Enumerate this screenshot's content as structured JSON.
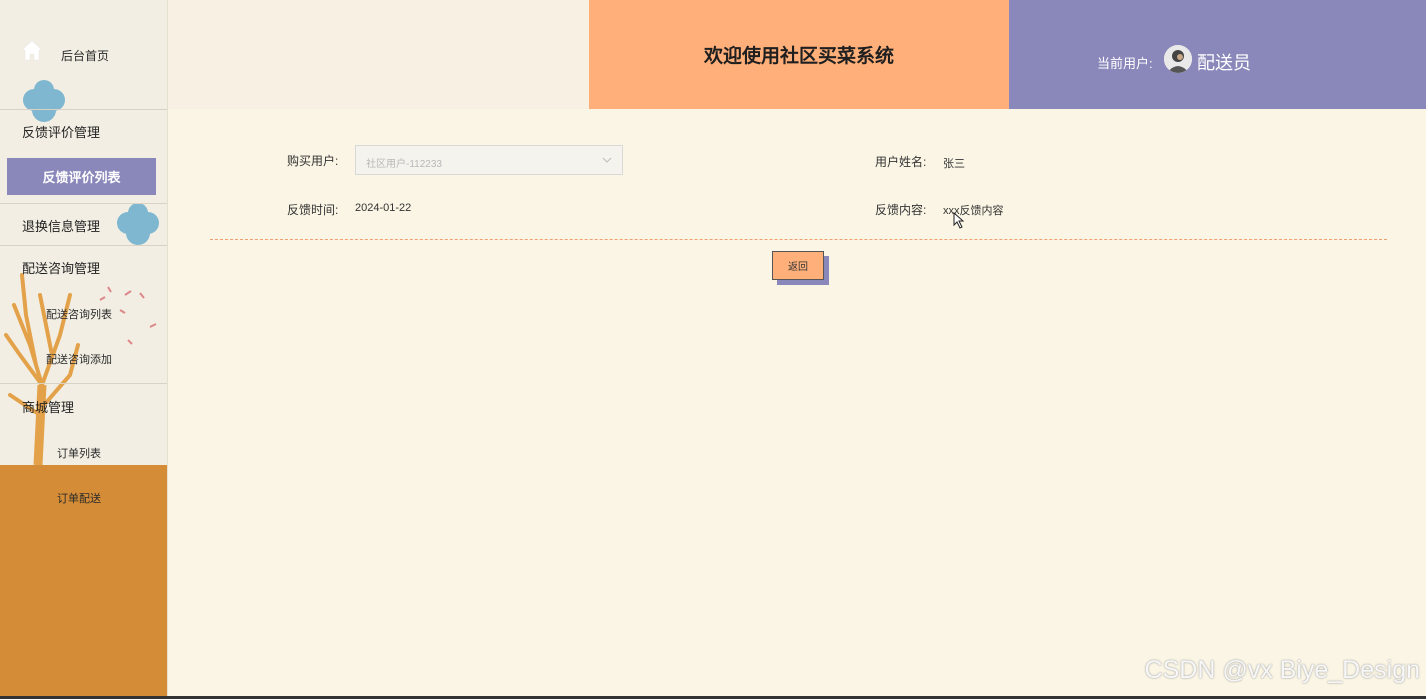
{
  "sidebar": {
    "home_label": "后台首页",
    "groups": [
      {
        "title": "反馈评价管理",
        "items": [
          "反馈评价列表"
        ]
      },
      {
        "title": "退换信息管理",
        "items": []
      },
      {
        "title": "配送咨询管理",
        "items": [
          "配送咨询列表",
          "配送咨询添加"
        ]
      },
      {
        "title": "商城管理",
        "items": [
          "订单列表",
          "订单配送"
        ]
      }
    ],
    "active_item": "反馈评价列表"
  },
  "header": {
    "title": "欢迎使用社区买菜系统",
    "current_user_label": "当前用户:",
    "role": "配送员"
  },
  "form": {
    "buyer_label": "购买用户:",
    "buyer_value": "社区用户-112233",
    "username_label": "用户姓名:",
    "username_value": "张三",
    "time_label": "反馈时间:",
    "time_value": "2024-01-22",
    "content_label": "反馈内容:",
    "content_value": "xxx反馈内容"
  },
  "buttons": {
    "back": "返回"
  },
  "watermark": "CSDN @vx Biye_Design",
  "colors": {
    "accent_orange": "#ffb07a",
    "accent_purple": "#8a88ba",
    "sidebar_orange": "#d48c36",
    "background": "#faf5e4"
  }
}
